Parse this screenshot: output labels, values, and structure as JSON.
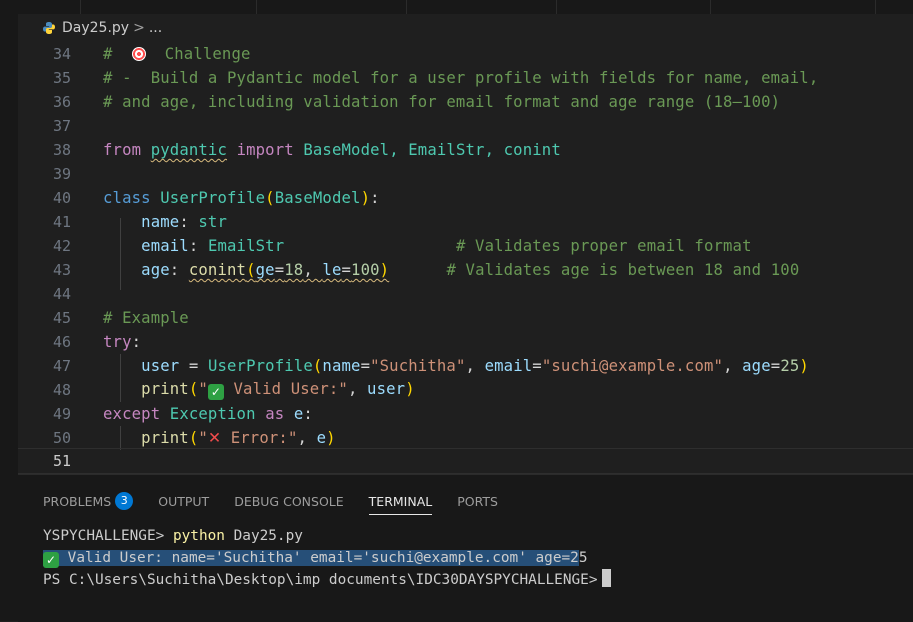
{
  "breadcrumb": {
    "file": "Day25.py",
    "separator": ">",
    "more": "..."
  },
  "code_lines": [
    {
      "n": "34"
    },
    {
      "n": "35"
    },
    {
      "n": "36"
    },
    {
      "n": "37"
    },
    {
      "n": "38"
    },
    {
      "n": "39"
    },
    {
      "n": "40"
    },
    {
      "n": "41"
    },
    {
      "n": "42"
    },
    {
      "n": "43"
    },
    {
      "n": "44"
    },
    {
      "n": "45"
    },
    {
      "n": "46"
    },
    {
      "n": "47"
    },
    {
      "n": "48"
    },
    {
      "n": "49"
    },
    {
      "n": "50"
    },
    {
      "n": "51"
    }
  ],
  "code": {
    "l34": "Challenge",
    "l35": "# -  Build a Pydantic model for a user profile with fields for name, email,",
    "l36": "# and age, including validation for email format and age range (18–100)",
    "l38_from": "from",
    "l38_mod": "pydantic",
    "l38_import": "import",
    "l38_names": "BaseModel, EmailStr, conint",
    "l40_class": "class",
    "l40_name": "UserProfile",
    "l40_base": "BaseModel",
    "l41_field": "name",
    "l41_type": "str",
    "l42_field": "email",
    "l42_type": "EmailStr",
    "l42_comment": "# Validates proper email format",
    "l43_field": "age",
    "l43_call": "conint",
    "l43_ge": "ge",
    "l43_gev": "18",
    "l43_le": "le",
    "l43_lev": "100",
    "l43_comment": "# Validates age is between 18 and 100",
    "l45": "# Example",
    "l46": "try",
    "l47_var": "user",
    "l47_cls": "UserProfile",
    "l47_k1": "name",
    "l47_v1": "\"Suchitha\"",
    "l47_k2": "email",
    "l47_v2": "\"suchi@example.com\"",
    "l47_k3": "age",
    "l47_v3": "25",
    "l48_fn": "print",
    "l48_str": "Valid User:\"",
    "l48_arg": "user",
    "l49_except": "except",
    "l49_exc": "Exception",
    "l49_as": "as",
    "l49_var": "e",
    "l50_fn": "print",
    "l50_str": "Error:\"",
    "l50_arg": "e"
  },
  "panel": {
    "tabs": [
      {
        "label": "PROBLEMS",
        "badge": "3"
      },
      {
        "label": "OUTPUT"
      },
      {
        "label": "DEBUG CONSOLE"
      },
      {
        "label": "TERMINAL",
        "active": true
      },
      {
        "label": "PORTS"
      }
    ]
  },
  "terminal": {
    "line1_prompt": "YSPYCHALLENGE> ",
    "line1_cmd": "python",
    "line1_arg": " Day25.py",
    "line2_selected": "Valid User: name='Suchitha' email='suchi@example.com' age=2",
    "line2_rest": "5",
    "line3": "PS C:\\Users\\Suchitha\\Desktop\\imp documents\\IDC30DAYSPYCHALLENGE>"
  },
  "colors": {
    "editor_bg": "#1f1f1f",
    "panel_bg": "#181818",
    "accent": "#0078d4",
    "selection": "#264f78"
  }
}
